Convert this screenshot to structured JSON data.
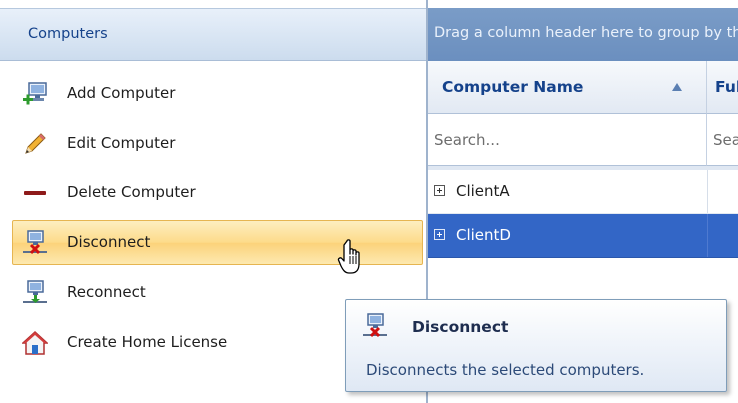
{
  "left_panel": {
    "header": "Computers",
    "actions": [
      {
        "label": "Add Computer",
        "icon": "add-computer-icon"
      },
      {
        "label": "Edit Computer",
        "icon": "pencil-icon"
      },
      {
        "label": "Delete Computer",
        "icon": "minus-icon"
      },
      {
        "label": "Disconnect",
        "icon": "disconnect-icon",
        "hovered": true
      },
      {
        "label": "Reconnect",
        "icon": "reconnect-icon"
      },
      {
        "label": "Create Home License",
        "icon": "home-icon"
      }
    ]
  },
  "grid": {
    "group_panel_text": "Drag a column header here to group by that column",
    "columns": [
      {
        "label": "Computer Name",
        "sorted": "ascending"
      },
      {
        "label": "Full Name"
      }
    ],
    "filter_placeholders": [
      "Search...",
      "Search..."
    ],
    "rows": [
      {
        "name": "ClientA",
        "selected": false
      },
      {
        "name": "ClientD",
        "selected": true
      }
    ]
  },
  "tooltip": {
    "title": "Disconnect",
    "description": "Disconnects the selected computers."
  },
  "colors": {
    "header_text": "#15428b",
    "hover_background": "#fddb8a",
    "selection": "#3366c6",
    "group_panel": "#6b8fbf"
  }
}
